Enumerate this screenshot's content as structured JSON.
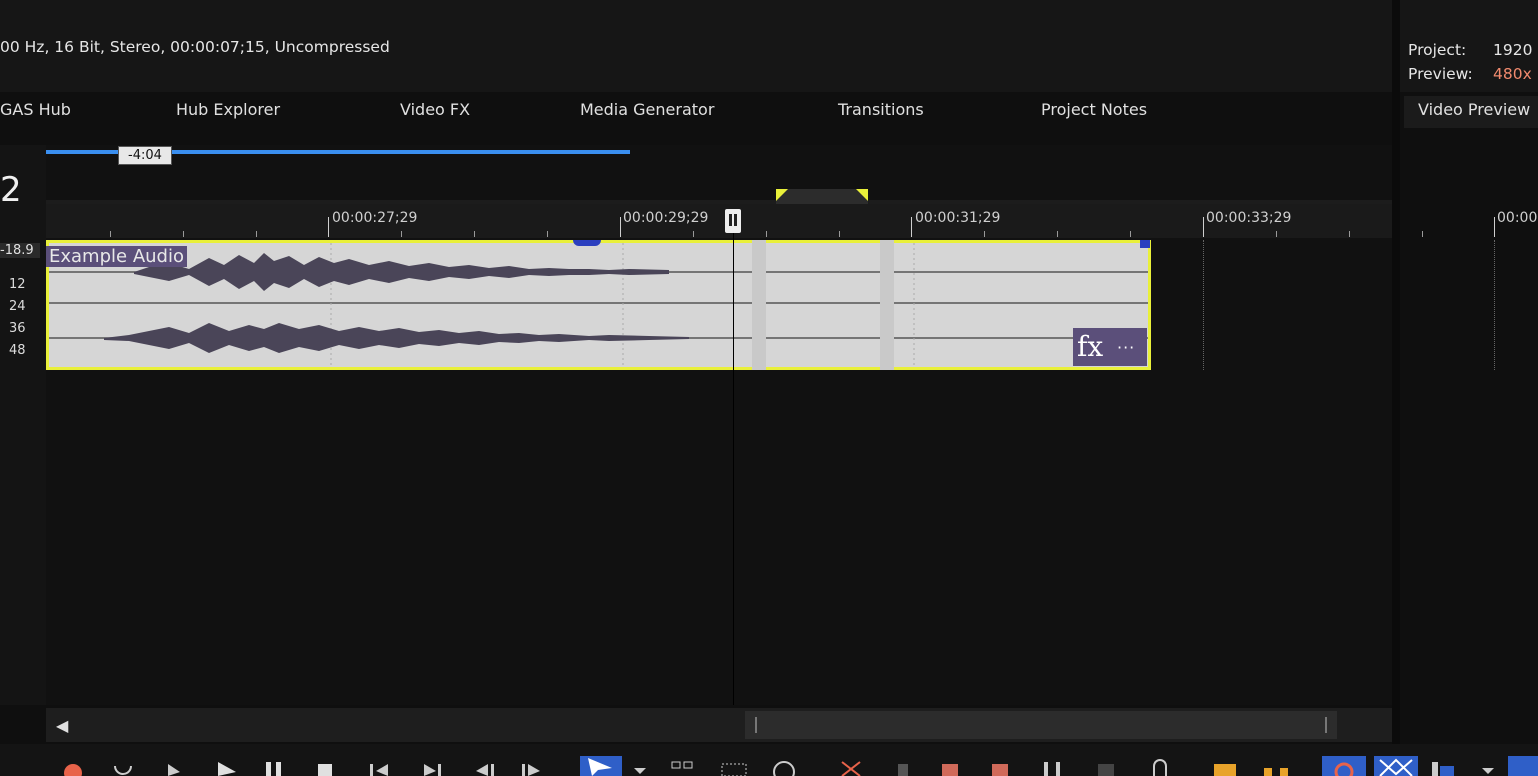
{
  "header": {
    "media_info": "00 Hz, 16 Bit, Stereo, 00:00:07;15, Uncompressed",
    "project_label": "Project:",
    "project_value": "1920",
    "preview_label": "Preview:",
    "preview_value": "480x"
  },
  "tabs": [
    {
      "label": "GAS Hub"
    },
    {
      "label": "Hub Explorer"
    },
    {
      "label": "Video FX"
    },
    {
      "label": "Media Generator"
    },
    {
      "label": "Transitions"
    },
    {
      "label": "Project Notes"
    }
  ],
  "right_tab": {
    "label": "Video Preview"
  },
  "timeline": {
    "loop_region_label": "-4:04",
    "track_number": "2",
    "volume_readout": "-18.9",
    "db_scale": [
      "12",
      "24",
      "36",
      "48"
    ],
    "ruler_labels": [
      "00:00:27;29",
      "00:00:29;29",
      "00:00:31;29",
      "00:00:33;29",
      "00:00:"
    ],
    "event_label": "Example Audio",
    "fx_label": "fx",
    "fx_more": "···"
  },
  "colors": {
    "accent_blue": "#3a8ff0",
    "event_border": "#e9f03a",
    "event_label_bg": "#5b4f7a",
    "preview_value": "#f08a6e"
  }
}
